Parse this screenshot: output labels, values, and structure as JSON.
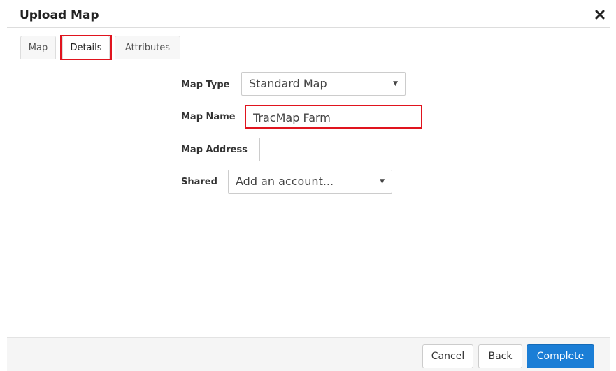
{
  "dialog": {
    "title": "Upload Map",
    "close_icon": "close-icon"
  },
  "tabs": [
    {
      "label": "Map",
      "active": false
    },
    {
      "label": "Details",
      "active": true
    },
    {
      "label": "Attributes",
      "active": false
    }
  ],
  "form": {
    "map_type": {
      "label": "Map Type",
      "value": "Standard Map"
    },
    "map_name": {
      "label": "Map Name",
      "value": "TracMap Farm"
    },
    "map_address": {
      "label": "Map Address",
      "value": ""
    },
    "shared": {
      "label": "Shared",
      "placeholder": "Add an account..."
    }
  },
  "footer": {
    "cancel_label": "Cancel",
    "back_label": "Back",
    "complete_label": "Complete"
  },
  "colors": {
    "highlight": "#e0141e",
    "primary": "#1b7ed6"
  }
}
